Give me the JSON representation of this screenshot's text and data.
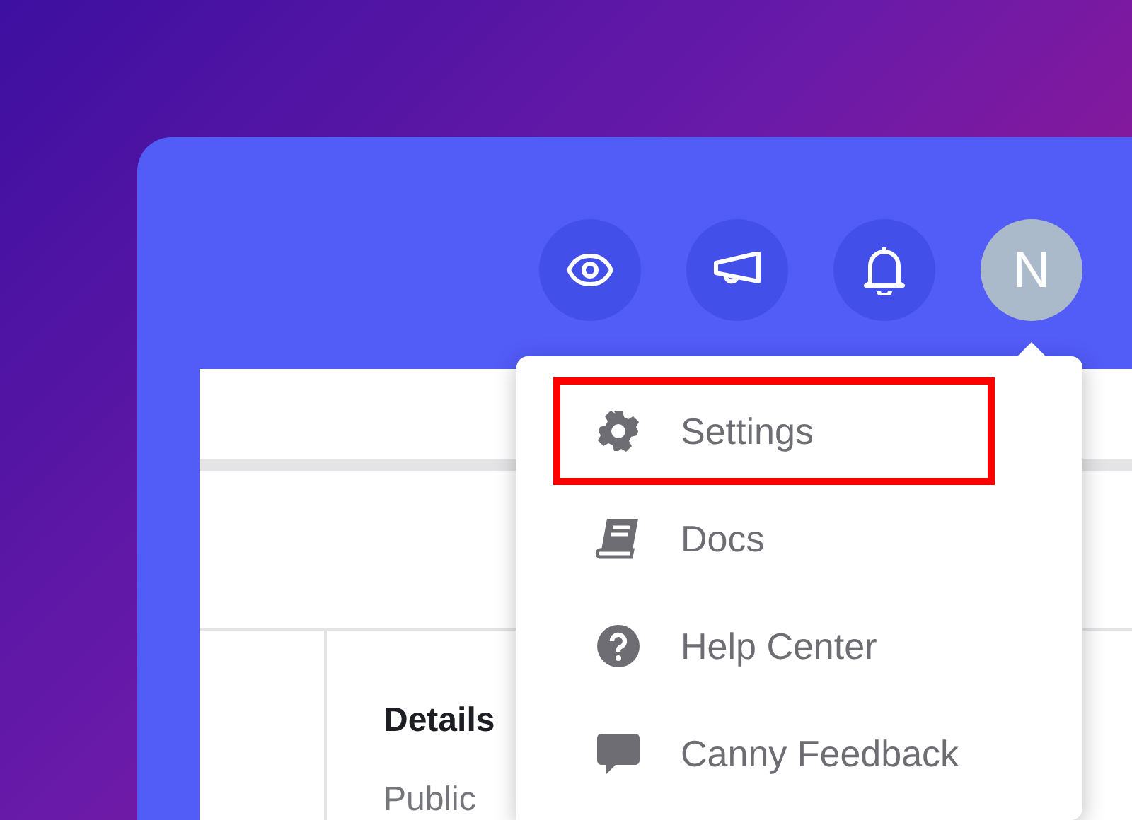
{
  "toolbar": {
    "buttons": [
      {
        "kind": "eye"
      },
      {
        "kind": "megaphone"
      },
      {
        "kind": "bell"
      }
    ],
    "avatar": {
      "initial": "N"
    }
  },
  "panel": {
    "heading": "Details",
    "field_label": "Public"
  },
  "menu": {
    "items": [
      {
        "kind": "gear",
        "label": "Settings",
        "highlighted": true
      },
      {
        "kind": "book",
        "label": "Docs",
        "highlighted": false
      },
      {
        "kind": "help",
        "label": "Help Center",
        "highlighted": false
      },
      {
        "kind": "chat",
        "label": "Canny Feedback",
        "highlighted": false
      }
    ]
  }
}
